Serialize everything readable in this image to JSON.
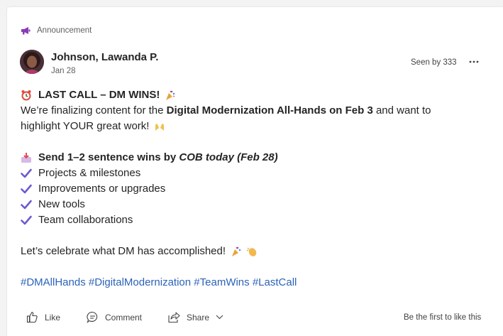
{
  "post": {
    "announcement_label": "Announcement",
    "author": "Johnson, Lawanda P.",
    "date": "Jan 28",
    "seen_by": "Seen by 333",
    "more_icon": "more-horizontal-icon",
    "colors": {
      "accent": "#8a3ab9",
      "check": "#6b5bd2",
      "hashtag": "#2b63b8"
    }
  },
  "content": {
    "title": "LAST CALL – DM WINS!",
    "intro_1": "We’re finalizing content for the ",
    "intro_bold": "Digital Modernization All-Hands on Feb 3",
    "intro_2": " and want to",
    "intro_3": "highlight YOUR great work!",
    "send_1": "Send 1–2 sentence wins by ",
    "send_2": "COB today (Feb 28)",
    "checklist": [
      "Projects & milestones",
      "Improvements or upgrades",
      "New tools",
      "Team collaborations"
    ],
    "celebrate": "Let’s celebrate what DM has accomplished!",
    "hashtags": [
      "#DMAllHands",
      "#DigitalModernization",
      "#TeamWins",
      "#LastCall"
    ]
  },
  "actions": {
    "like": "Like",
    "comment": "Comment",
    "share": "Share",
    "first_like": "Be the first to like this"
  }
}
